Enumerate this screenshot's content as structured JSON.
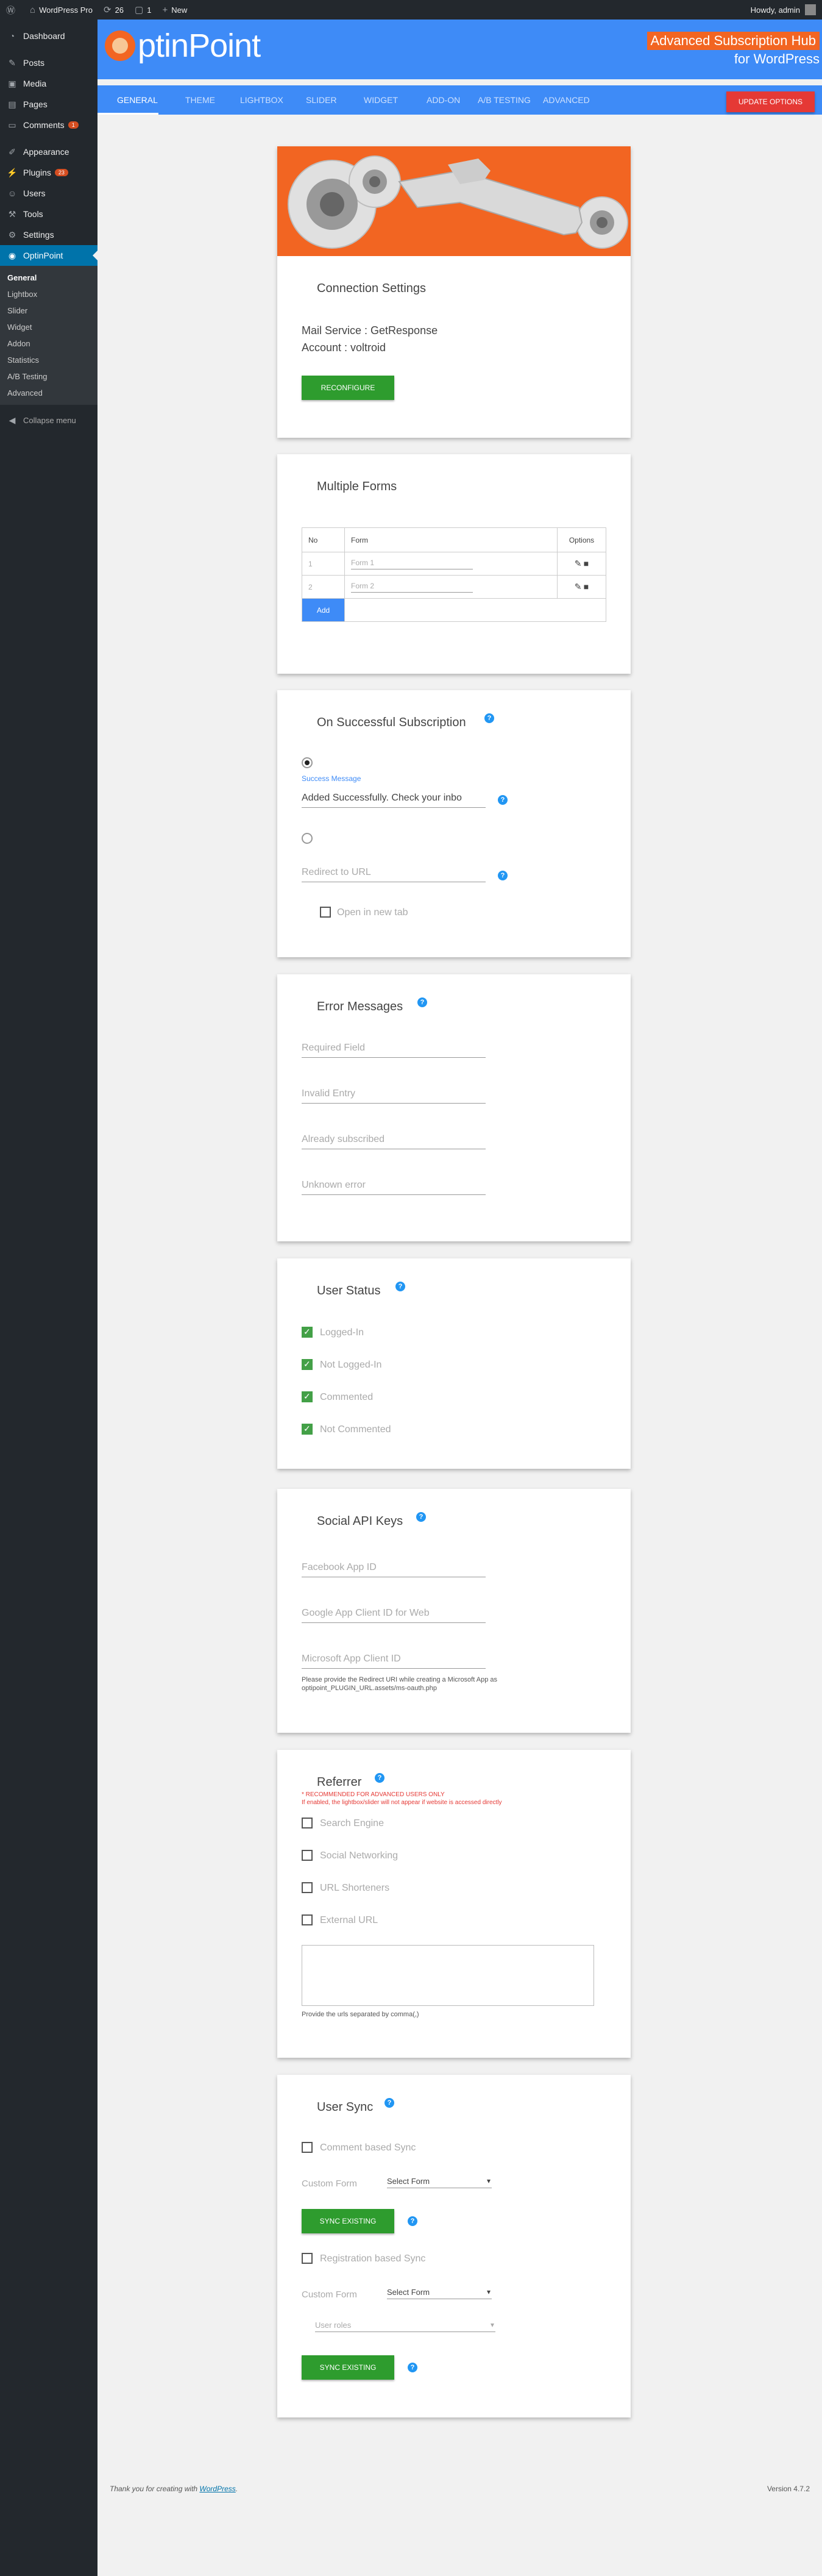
{
  "adminbar": {
    "site": "WordPress Pro",
    "updates": "26",
    "comments": "1",
    "new": "New",
    "howdy": "Howdy, admin"
  },
  "sidebar": {
    "items": [
      {
        "label": "Dashboard"
      },
      {
        "label": "Posts"
      },
      {
        "label": "Media"
      },
      {
        "label": "Pages"
      },
      {
        "label": "Comments",
        "badge": "1"
      },
      {
        "label": "Appearance"
      },
      {
        "label": "Plugins",
        "badge": "23"
      },
      {
        "label": "Users"
      },
      {
        "label": "Tools"
      },
      {
        "label": "Settings"
      },
      {
        "label": "OptinPoint"
      }
    ],
    "submenu": [
      "General",
      "Lightbox",
      "Slider",
      "Widget",
      "Addon",
      "Statistics",
      "A/B Testing",
      "Advanced"
    ],
    "collapse": "Collapse menu"
  },
  "header": {
    "logo_text": "ptinPoint",
    "tagline_1": "Advanced Subscription Hub",
    "tagline_2": "for WordPress"
  },
  "nav": {
    "tabs": [
      "GENERAL",
      "THEME",
      "LIGHTBOX",
      "SLIDER",
      "WIDGET",
      "ADD-ON",
      "A/B TESTING",
      "ADVANCED"
    ],
    "update": "UPDATE OPTIONS"
  },
  "connection": {
    "title": "Connection Settings",
    "mail_service": "Mail Service : GetResponse",
    "account": "Account : voltroid",
    "reconfigure": "RECONFIGURE"
  },
  "forms": {
    "title": "Multiple Forms",
    "headers": [
      "No",
      "Form",
      "Options"
    ],
    "rows": [
      {
        "no": "1",
        "form": "Form 1"
      },
      {
        "no": "2",
        "form": "Form 2"
      }
    ],
    "add": "Add"
  },
  "success": {
    "title": "On Successful Subscription",
    "message_label": "Success Message",
    "message_value": "Added Successfully. Check your inbo",
    "redirect_placeholder": "Redirect to URL",
    "new_tab": "Open in new tab"
  },
  "errors": {
    "title": "Error Messages",
    "fields": [
      "Required Field",
      "Invalid Entry",
      "Already subscribed",
      "Unknown error"
    ]
  },
  "user_status": {
    "title": "User Status",
    "options": [
      "Logged-In",
      "Not Logged-In",
      "Commented",
      "Not Commented"
    ]
  },
  "social": {
    "title": "Social API Keys",
    "fields": [
      "Facebook App ID",
      "Google App Client ID for Web",
      "Microsoft App Client ID"
    ],
    "note": "Please provide the Redirect URI while creating a Microsoft App as optipoint_PLUGIN_URL.assets/ms-oauth.php"
  },
  "referrer": {
    "title": "Referrer",
    "warn_1": "* RECOMMENDED FOR ADVANCED USERS ONLY",
    "warn_2": "If enabled, the lightbox/slider will not appear if website is accessed directly",
    "options": [
      "Search Engine",
      "Social Networking",
      "URL Shorteners",
      "External URL"
    ],
    "hint": "Provide the urls separated by comma(,)"
  },
  "user_sync": {
    "title": "User Sync",
    "comment_sync": "Comment based Sync",
    "custom_form": "Custom Form",
    "select_form": "Select Form",
    "sync_existing": "SYNC EXISTING",
    "registration_sync": "Registration based Sync",
    "user_roles": "User roles"
  },
  "footer": {
    "thanks": "Thank you for creating with",
    "wp": "WordPress",
    "version": "Version 4.7.2"
  },
  "colors": {
    "brand_blue": "#3e8bf7",
    "accent_orange": "#f26522",
    "button_green": "#2e9c2e",
    "update_red": "#e53935"
  }
}
